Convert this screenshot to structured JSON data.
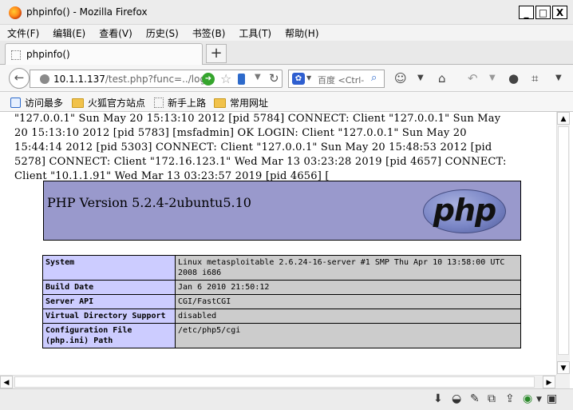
{
  "window": {
    "title": "phpinfo() - Mozilla Firefox",
    "controls": {
      "minimize": "_",
      "maximize": "□",
      "close": "X"
    }
  },
  "menu": {
    "items": [
      "文件(F)",
      "编辑(E)",
      "查看(V)",
      "历史(S)",
      "书签(B)",
      "工具(T)",
      "帮助(H)"
    ]
  },
  "tabs": {
    "active_label": "phpinfo()",
    "new_tab_label": "+"
  },
  "navbar": {
    "url_host": "10.1.1.137",
    "url_rest": "/test.php?func=../log",
    "search_placeholder": "百度 <Ctrl-"
  },
  "bookmarks": {
    "items": [
      "访问最多",
      "火狐官方站点",
      "新手上路",
      "常用网址"
    ]
  },
  "log_lines": [
    "\"127.0.0.1\" Sun May 20 15:13:10 2012 [pid 5784] CONNECT: Client \"127.0.0.1\" Sun May",
    "20 15:13:10 2012 [pid 5783] [msfadmin] OK LOGIN: Client \"127.0.0.1\" Sun May 20",
    "15:44:14 2012 [pid 5303] CONNECT: Client \"127.0.0.1\" Sun May 20 15:48:53 2012 [pid",
    "5278] CONNECT: Client \"172.16.123.1\" Wed Mar 13 03:23:28 2019 [pid 4657] CONNECT:",
    "Client \"10.1.1.91\" Wed Mar 13 03:23:57 2019 [pid 4656] ["
  ],
  "php": {
    "version_title": "PHP Version 5.2.4-2ubuntu5.10",
    "logo_text": "php",
    "rows": [
      {
        "key": "System",
        "value": "Linux metasploitable 2.6.24-16-server #1 SMP Thu Apr 10 13:58:00 UTC 2008 i686"
      },
      {
        "key": "Build Date",
        "value": "Jan 6 2010 21:50:12"
      },
      {
        "key": "Server API",
        "value": "CGI/FastCGI"
      },
      {
        "key": "Virtual Directory Support",
        "value": "disabled"
      },
      {
        "key": "Configuration File (php.ini) Path",
        "value": "/etc/php5/cgi"
      }
    ]
  }
}
